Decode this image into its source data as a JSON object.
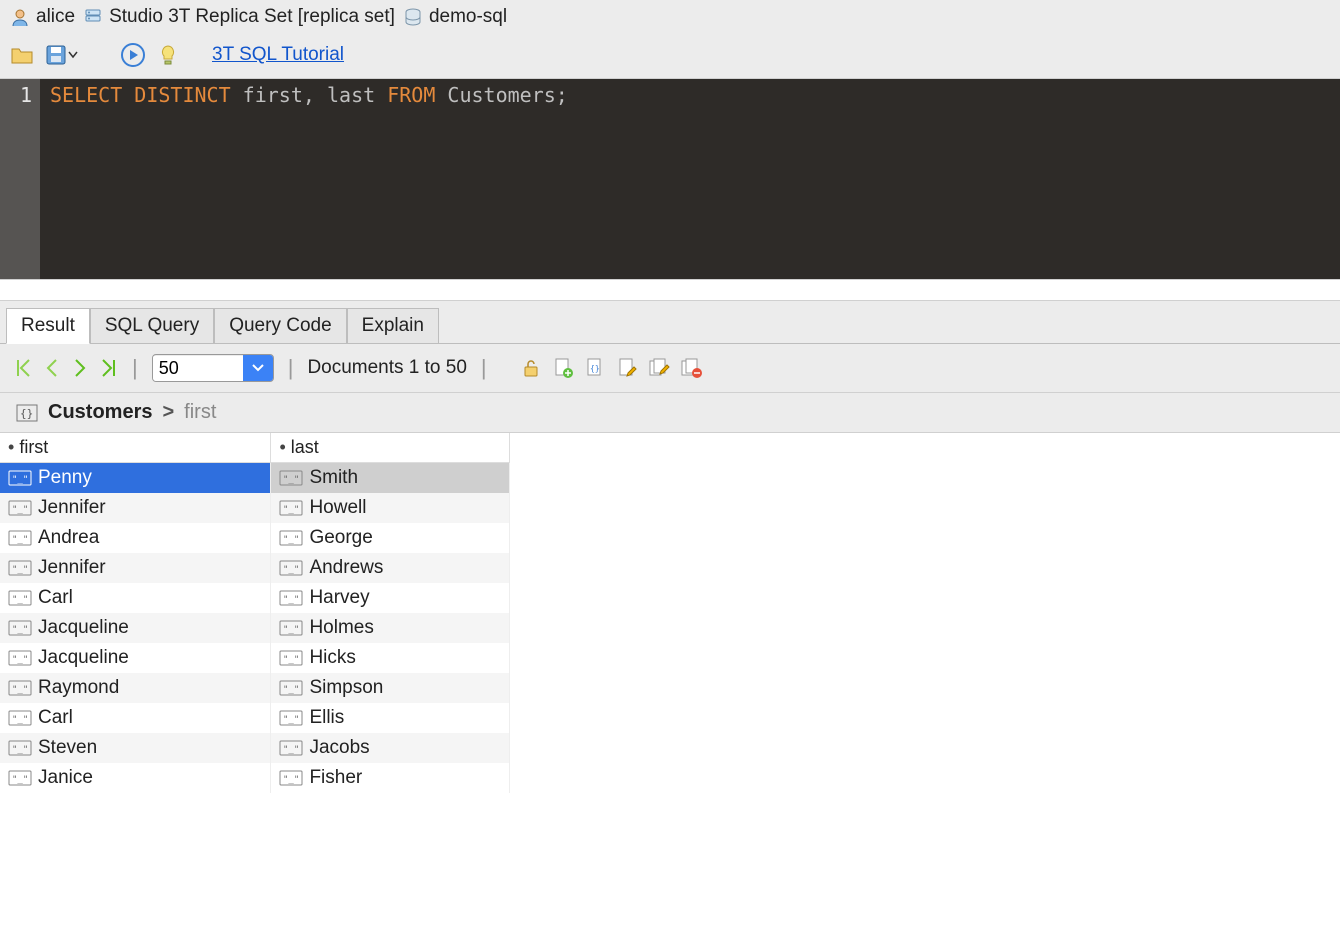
{
  "breadcrumb": {
    "user": "alice",
    "connection": "Studio 3T Replica Set [replica set]",
    "database": "demo-sql"
  },
  "toolbar": {
    "tutorial_link": "3T SQL Tutorial"
  },
  "editor": {
    "line_number": "1",
    "tokens": {
      "select": "SELECT",
      "distinct": "DISTINCT",
      "first": "first",
      "comma": ",",
      "last": "last",
      "from": "FROM",
      "customers": "Customers",
      "semi": ";"
    }
  },
  "tabs": [
    "Result",
    "SQL Query",
    "Query Code",
    "Explain"
  ],
  "active_tab": 0,
  "paging": {
    "page_size": "50",
    "doc_range": "Documents 1 to 50"
  },
  "path": {
    "collection": "Customers",
    "gt": ">",
    "field": "first"
  },
  "columns": [
    "first",
    "last"
  ],
  "rows": [
    {
      "first": "Penny",
      "last": "Smith",
      "selected": true
    },
    {
      "first": "Jennifer",
      "last": "Howell"
    },
    {
      "first": "Andrea",
      "last": "George"
    },
    {
      "first": "Jennifer",
      "last": "Andrews"
    },
    {
      "first": "Carl",
      "last": "Harvey"
    },
    {
      "first": "Jacqueline",
      "last": "Holmes"
    },
    {
      "first": "Jacqueline",
      "last": "Hicks"
    },
    {
      "first": "Raymond",
      "last": "Simpson"
    },
    {
      "first": "Carl",
      "last": "Ellis"
    },
    {
      "first": "Steven",
      "last": "Jacobs"
    },
    {
      "first": "Janice",
      "last": "Fisher"
    }
  ]
}
